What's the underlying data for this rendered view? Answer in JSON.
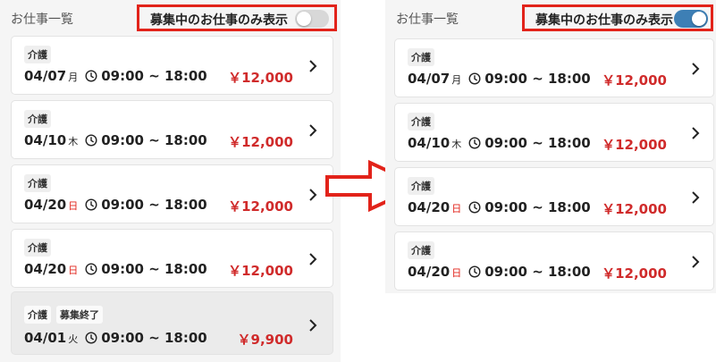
{
  "left_panel": {
    "section_title": "お仕事一覧",
    "filter_label": "募集中のお仕事のみ表示",
    "toggle_on": false,
    "jobs": [
      {
        "tags": [
          "介護"
        ],
        "date": "04/07",
        "weekday": "月",
        "holiday": false,
        "time": "09:00 ~ 18:00",
        "price": "￥12,000",
        "closed": false
      },
      {
        "tags": [
          "介護"
        ],
        "date": "04/10",
        "weekday": "木",
        "holiday": false,
        "time": "09:00 ~ 18:00",
        "price": "￥12,000",
        "closed": false
      },
      {
        "tags": [
          "介護"
        ],
        "date": "04/20",
        "weekday": "日",
        "holiday": true,
        "time": "09:00 ~ 18:00",
        "price": "￥12,000",
        "closed": false
      },
      {
        "tags": [
          "介護"
        ],
        "date": "04/20",
        "weekday": "日",
        "holiday": true,
        "time": "09:00 ~ 18:00",
        "price": "￥12,000",
        "closed": false
      },
      {
        "tags": [
          "介護",
          "募集終了"
        ],
        "date": "04/01",
        "weekday": "火",
        "holiday": false,
        "time": "09:00 ~ 18:00",
        "price": "￥9,900",
        "closed": true
      }
    ]
  },
  "right_panel": {
    "section_title": "お仕事一覧",
    "filter_label": "募集中のお仕事のみ表示",
    "toggle_on": true,
    "jobs": [
      {
        "tags": [
          "介護"
        ],
        "date": "04/07",
        "weekday": "月",
        "holiday": false,
        "time": "09:00 ~ 18:00",
        "price": "￥12,000",
        "closed": false
      },
      {
        "tags": [
          "介護"
        ],
        "date": "04/10",
        "weekday": "木",
        "holiday": false,
        "time": "09:00 ~ 18:00",
        "price": "￥12,000",
        "closed": false
      },
      {
        "tags": [
          "介護"
        ],
        "date": "04/20",
        "weekday": "日",
        "holiday": true,
        "time": "09:00 ~ 18:00",
        "price": "￥12,000",
        "closed": false
      },
      {
        "tags": [
          "介護"
        ],
        "date": "04/20",
        "weekday": "日",
        "holiday": true,
        "time": "09:00 ~ 18:00",
        "price": "￥12,000",
        "closed": false
      }
    ]
  },
  "colors": {
    "highlight": "#e2231a",
    "price": "#d02b2b",
    "toggle_on": "#3d7fb5",
    "toggle_off": "#d8d8d8"
  },
  "icons": {
    "clock": "clock-icon",
    "chevron": "chevron-right-icon",
    "arrow": "arrow-right-icon"
  }
}
